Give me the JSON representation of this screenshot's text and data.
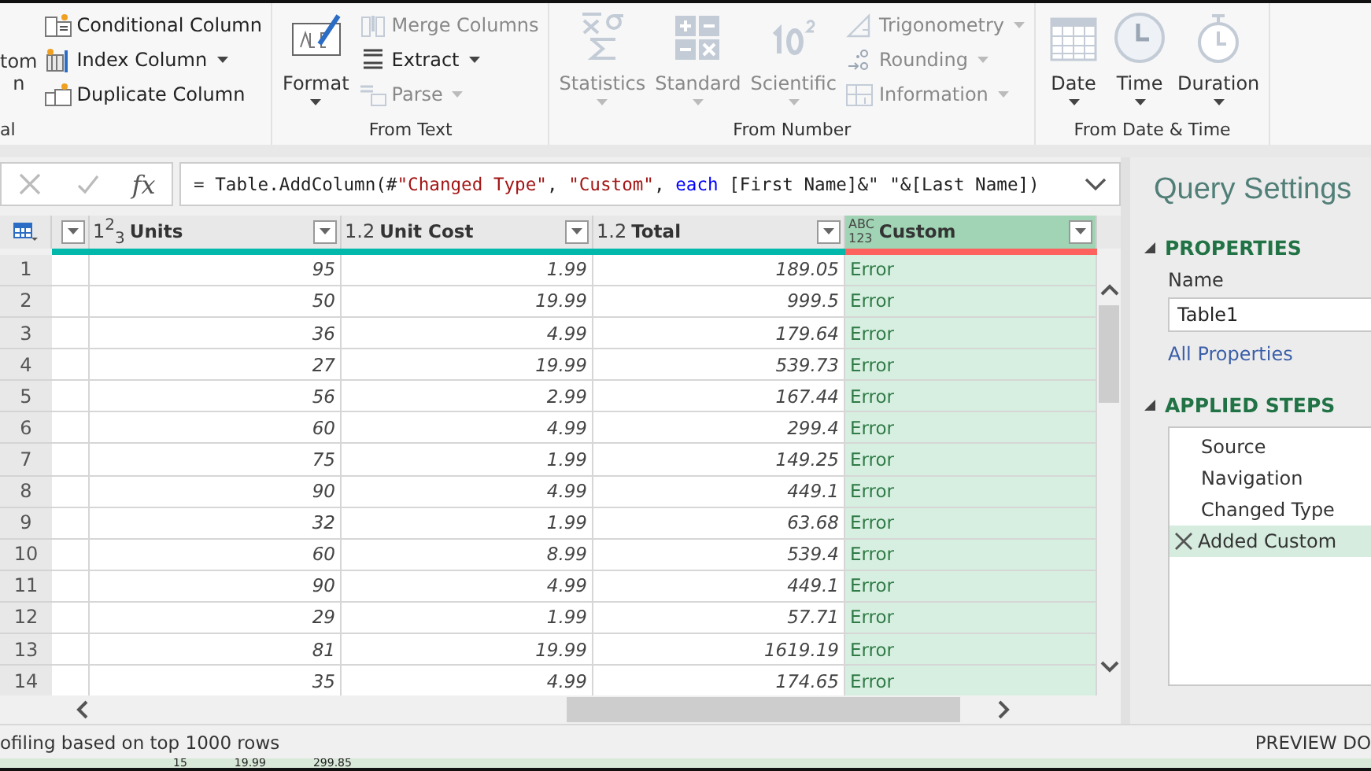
{
  "ribbon": {
    "groups": [
      {
        "label": "al",
        "items": [
          {
            "kind": "large",
            "label": "tom\nn",
            "dropdown": false,
            "disabled": false
          },
          {
            "kind": "stack",
            "buttons": [
              {
                "label": "Conditional Column",
                "dropdown": false,
                "disabled": false
              },
              {
                "label": "Index Column",
                "dropdown": true,
                "disabled": false
              },
              {
                "label": "Duplicate Column",
                "dropdown": false,
                "disabled": false
              }
            ]
          }
        ]
      },
      {
        "label": "From Text",
        "items": [
          {
            "kind": "large",
            "label": "Format",
            "dropdown": true,
            "disabled": false
          },
          {
            "kind": "stack",
            "buttons": [
              {
                "label": "Merge Columns",
                "dropdown": false,
                "disabled": true
              },
              {
                "label": "Extract",
                "dropdown": true,
                "disabled": false
              },
              {
                "label": "Parse",
                "dropdown": true,
                "disabled": true
              }
            ]
          }
        ]
      },
      {
        "label": "From Number",
        "items": [
          {
            "kind": "large",
            "label": "Statistics",
            "dropdown": true,
            "disabled": true
          },
          {
            "kind": "large",
            "label": "Standard",
            "dropdown": true,
            "disabled": true
          },
          {
            "kind": "large",
            "label": "Scientific",
            "dropdown": true,
            "disabled": true
          },
          {
            "kind": "stack",
            "buttons": [
              {
                "label": "Trigonometry",
                "dropdown": true,
                "disabled": true
              },
              {
                "label": "Rounding",
                "dropdown": true,
                "disabled": true
              },
              {
                "label": "Information",
                "dropdown": true,
                "disabled": true
              }
            ]
          }
        ]
      },
      {
        "label": "From Date & Time",
        "items": [
          {
            "kind": "large",
            "label": "Date",
            "dropdown": true,
            "disabled": false
          },
          {
            "kind": "large",
            "label": "Time",
            "dropdown": true,
            "disabled": false
          },
          {
            "kind": "large",
            "label": "Duration",
            "dropdown": true,
            "disabled": false
          }
        ]
      }
    ]
  },
  "formula_bar": {
    "function_label": "fx",
    "formula": [
      {
        "kind": "plain",
        "text": "= Table.AddColumn(#"
      },
      {
        "kind": "string",
        "text": "\"Changed Type\""
      },
      {
        "kind": "plain",
        "text": ", "
      },
      {
        "kind": "string",
        "text": "\"Custom\""
      },
      {
        "kind": "plain",
        "text": ", "
      },
      {
        "kind": "keyword",
        "text": "each"
      },
      {
        "kind": "plain",
        "text": " [First Name]&\" \"&[Last Name])"
      }
    ]
  },
  "table": {
    "columns": [
      {
        "custom": false
      },
      {
        "type": "1$^{2}$$_{3}$",
        "name": "Units",
        "custom": false
      },
      {
        "type": "1.2",
        "name": "Unit Cost",
        "custom": false
      },
      {
        "type": "1.2",
        "name": "Total",
        "custom": false
      },
      {
        "type_lines": [
          "ABC",
          "123"
        ],
        "name": "Custom",
        "custom": true
      }
    ],
    "rows": [
      {
        "number": "1",
        "cells": [
          "",
          "95",
          "1.99",
          "189.05",
          "Error"
        ]
      },
      {
        "number": "2",
        "cells": [
          "",
          "50",
          "19.99",
          "999.5",
          "Error"
        ]
      },
      {
        "number": "3",
        "cells": [
          "",
          "36",
          "4.99",
          "179.64",
          "Error"
        ]
      },
      {
        "number": "4",
        "cells": [
          "",
          "27",
          "19.99",
          "539.73",
          "Error"
        ]
      },
      {
        "number": "5",
        "cells": [
          "",
          "56",
          "2.99",
          "167.44",
          "Error"
        ]
      },
      {
        "number": "6",
        "cells": [
          "",
          "60",
          "4.99",
          "299.4",
          "Error"
        ]
      },
      {
        "number": "7",
        "cells": [
          "",
          "75",
          "1.99",
          "149.25",
          "Error"
        ]
      },
      {
        "number": "8",
        "cells": [
          "",
          "90",
          "4.99",
          "449.1",
          "Error"
        ]
      },
      {
        "number": "9",
        "cells": [
          "",
          "32",
          "1.99",
          "63.68",
          "Error"
        ]
      },
      {
        "number": "10",
        "cells": [
          "",
          "60",
          "8.99",
          "539.4",
          "Error"
        ]
      },
      {
        "number": "11",
        "cells": [
          "",
          "90",
          "4.99",
          "449.1",
          "Error"
        ]
      },
      {
        "number": "12",
        "cells": [
          "",
          "29",
          "1.99",
          "57.71",
          "Error"
        ]
      },
      {
        "number": "13",
        "cells": [
          "",
          "81",
          "19.99",
          "1619.19",
          "Error"
        ]
      },
      {
        "number": "14",
        "cells": [
          "",
          "35",
          "4.99",
          "174.65",
          "Error"
        ]
      }
    ]
  },
  "query_settings": {
    "title": "Query Settings",
    "properties": {
      "heading": "PROPERTIES",
      "expanded": true,
      "name_label": "Name",
      "name_value": "Table1",
      "link": "All Properties"
    },
    "applied_steps": {
      "heading": "APPLIED STEPS",
      "expanded": true,
      "steps": [
        {
          "label": "Source",
          "selected": false
        },
        {
          "label": "Navigation",
          "selected": false
        },
        {
          "label": "Changed Type",
          "selected": false
        },
        {
          "label": "Added Custom",
          "selected": true
        }
      ]
    }
  },
  "status_bar": {
    "left": "ofiling based on top 1000 rows",
    "right": "PREVIEW DO"
  },
  "background_sheet": [
    "15",
    "19.99",
    "299.85"
  ]
}
